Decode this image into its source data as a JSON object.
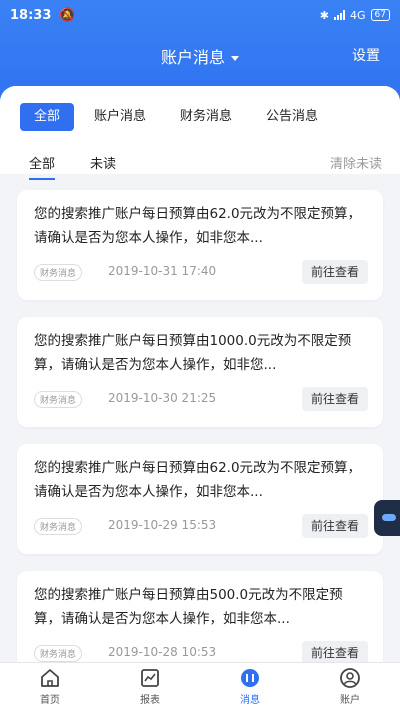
{
  "status": {
    "time": "18:33",
    "network": "4G",
    "battery": "67"
  },
  "nav": {
    "title": "账户消息",
    "settings": "设置"
  },
  "category_tabs": [
    {
      "label": "全部",
      "active": true
    },
    {
      "label": "账户消息",
      "active": false
    },
    {
      "label": "财务消息",
      "active": false
    },
    {
      "label": "公告消息",
      "active": false
    }
  ],
  "sub_tabs": [
    {
      "label": "全部",
      "active": true
    },
    {
      "label": "未读",
      "active": false
    }
  ],
  "clear_unread": "清除未读",
  "messages": [
    {
      "text": "您的搜索推广账户每日预算由62.0元改为不限定预算，请确认是否为您本人操作，如非您本...",
      "tag": "财务消息",
      "date": "2019-10-31 17:40",
      "action": "前往查看"
    },
    {
      "text": "您的搜索推广账户每日预算由1000.0元改为不限定预算，请确认是否为您本人操作，如非您...",
      "tag": "财务消息",
      "date": "2019-10-30 21:25",
      "action": "前往查看"
    },
    {
      "text": "您的搜索推广账户每日预算由62.0元改为不限定预算，请确认是否为您本人操作，如非您本...",
      "tag": "财务消息",
      "date": "2019-10-29 15:53",
      "action": "前往查看"
    },
    {
      "text": "您的搜索推广账户每日预算由500.0元改为不限定预算，请确认是否为您本人操作，如非您本...",
      "tag": "财务消息",
      "date": "2019-10-28 10:53",
      "action": "前往查看"
    }
  ],
  "tabbar": [
    {
      "label": "首页",
      "icon": "home-icon"
    },
    {
      "label": "报表",
      "icon": "chart-icon"
    },
    {
      "label": "消息",
      "icon": "message-icon",
      "active": true
    },
    {
      "label": "账户",
      "icon": "user-icon"
    }
  ],
  "colors": {
    "primary": "#2f6ff0",
    "background": "#f2f4f7"
  }
}
